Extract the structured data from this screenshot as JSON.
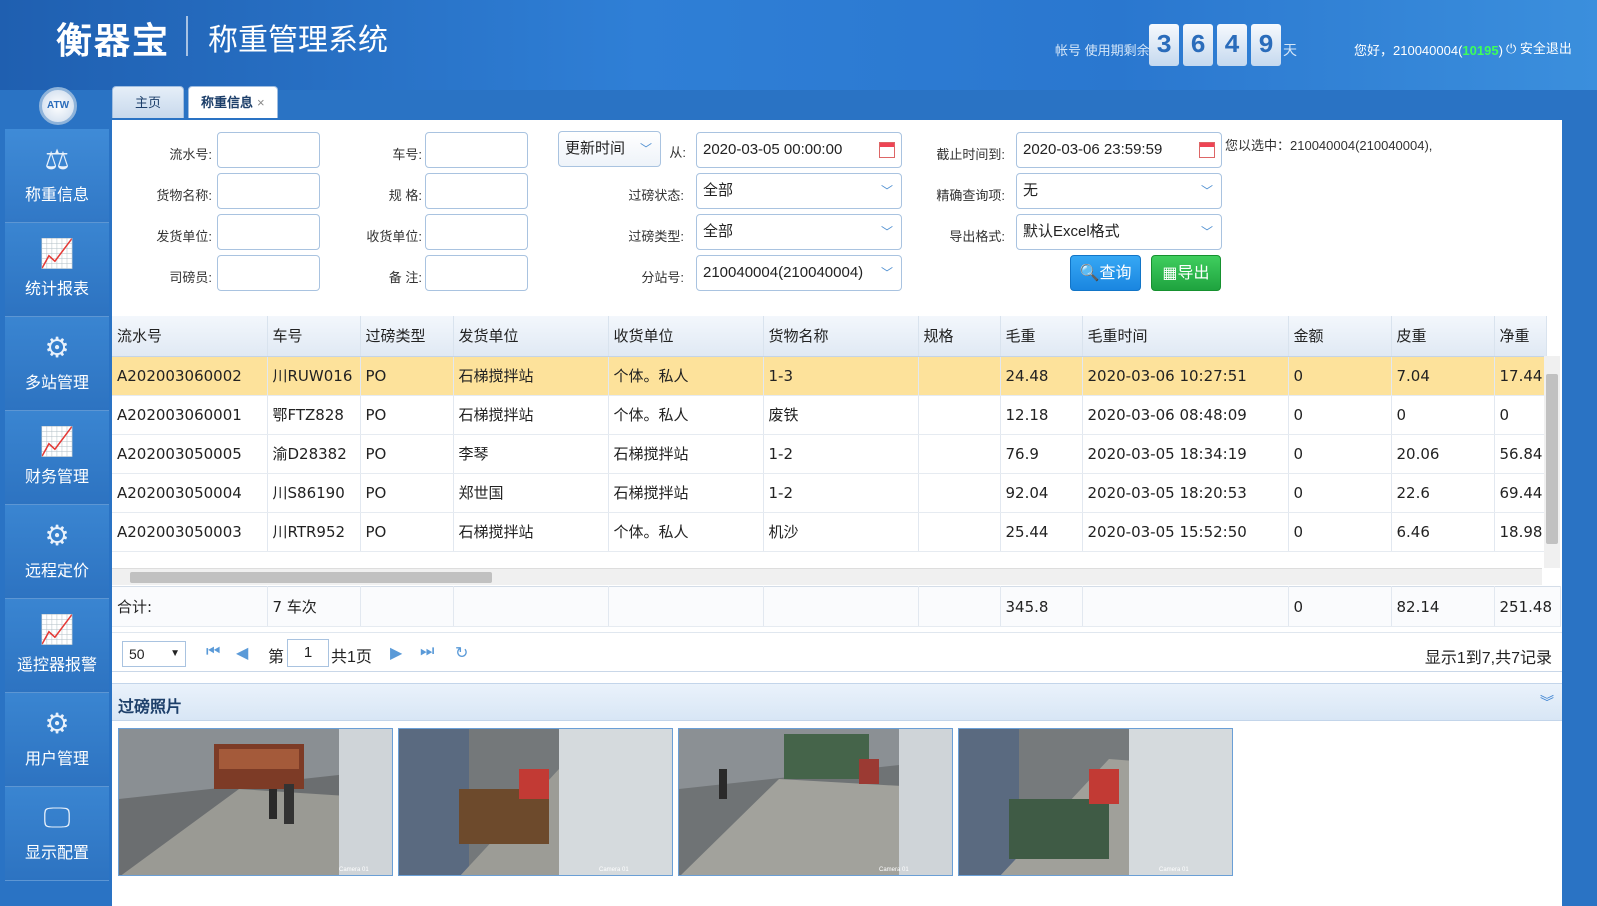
{
  "header": {
    "brand": "衡器宝",
    "system_title": "称重管理系统",
    "expire_label": "帐号 使用期剩余",
    "days": [
      "3",
      "6",
      "4",
      "9"
    ],
    "days_unit": "天",
    "greeting_prefix": "您好，210040004(",
    "user_code": "10195",
    "greeting_suffix": ")",
    "logout": "安全退出"
  },
  "sidebar": {
    "logo": "ATW",
    "items": [
      {
        "label": "称重信息",
        "icon": "scale-icon",
        "glyph": "⚖"
      },
      {
        "label": "统计报表",
        "icon": "chart-icon",
        "glyph": "📈"
      },
      {
        "label": "多站管理",
        "icon": "gear-icon",
        "glyph": "⚙"
      },
      {
        "label": "财务管理",
        "icon": "chart-icon",
        "glyph": "📈"
      },
      {
        "label": "远程定价",
        "icon": "gear-icon",
        "glyph": "⚙"
      },
      {
        "label": "遥控器报警",
        "icon": "chart-icon",
        "glyph": "📈"
      },
      {
        "label": "用户管理",
        "icon": "gear-icon",
        "glyph": "⚙"
      },
      {
        "label": "显示配置",
        "icon": "monitor-icon",
        "glyph": "🖵"
      }
    ]
  },
  "tabs": [
    {
      "label": "主页"
    },
    {
      "label": "称重信息",
      "close": "×"
    }
  ],
  "filters": {
    "serial_label": "流水号:",
    "plate_label": "车号:",
    "goods_label": "货物名称:",
    "spec_label": "规 格:",
    "sender_label": "发货单位:",
    "receiver_label": "收货单位:",
    "operator_label": "司磅员:",
    "remark_label": "备 注:",
    "time_type": "更新时间",
    "from_label": "从:",
    "from_value": "2020-03-05 00:00:00",
    "to_label": "截止时间到:",
    "to_value": "2020-03-06 23:59:59",
    "status_label": "过磅状态:",
    "status_value": "全部",
    "exact_label": "精确查询项:",
    "exact_value": "无",
    "type_label": "过磅类型:",
    "type_value": "全部",
    "export_label": "导出格式:",
    "export_value": "默认Excel格式",
    "station_label": "分站号:",
    "station_value": "210040004(210040004)",
    "query_btn": "查询",
    "export_btn": "导出",
    "selected_info": "您以选中：210040004(210040004),"
  },
  "grid": {
    "columns": [
      "流水号",
      "车号",
      "过磅类型",
      "发货单位",
      "收货单位",
      "货物名称",
      "规格",
      "毛重",
      "毛重时间",
      "金额",
      "皮重",
      "净重"
    ],
    "rows": [
      [
        "A202003060002",
        "川RUW016",
        "PO",
        "石梯搅拌站",
        "个体。私人",
        "1-3",
        "",
        "24.48",
        "2020-03-06 10:27:51",
        "0",
        "7.04",
        "17.44"
      ],
      [
        "A202003060001",
        "鄂FTZ828",
        "PO",
        "石梯搅拌站",
        "个体。私人",
        "废铁",
        "",
        "12.18",
        "2020-03-06 08:48:09",
        "0",
        "0",
        "0"
      ],
      [
        "A202003050005",
        "渝D28382",
        "PO",
        "李琴",
        "石梯搅拌站",
        "1-2",
        "",
        "76.9",
        "2020-03-05 18:34:19",
        "0",
        "20.06",
        "56.84"
      ],
      [
        "A202003050004",
        "川S86190",
        "PO",
        "郑世国",
        "石梯搅拌站",
        "1-2",
        "",
        "92.04",
        "2020-03-05 18:20:53",
        "0",
        "22.6",
        "69.44"
      ],
      [
        "A202003050003",
        "川RTR952",
        "PO",
        "石梯搅拌站",
        "个体。私人",
        "机沙",
        "",
        "25.44",
        "2020-03-05 15:52:50",
        "0",
        "6.46",
        "18.98"
      ]
    ],
    "footer": [
      "合计:",
      "7 车次",
      "",
      "",
      "",
      "",
      "",
      "345.8",
      "",
      "0",
      "82.14",
      "251.48"
    ]
  },
  "pager": {
    "page_size": "50",
    "page_prefix": "第",
    "page_value": "1",
    "page_total": "共1页",
    "info": "显示1到7,共7记录"
  },
  "photos": {
    "title": "过磅照片",
    "caption": "Camera 01"
  }
}
